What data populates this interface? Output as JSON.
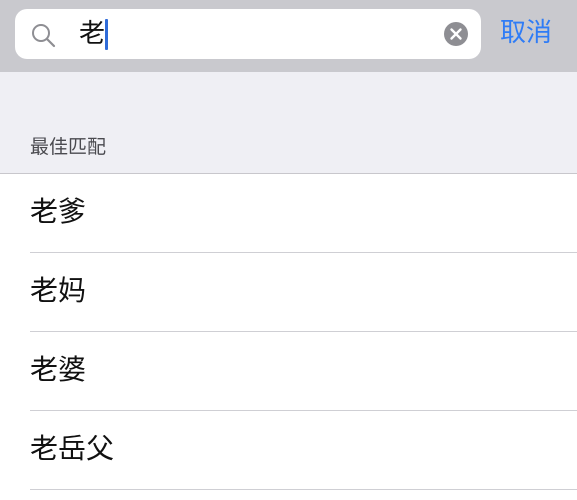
{
  "search": {
    "value": "老",
    "cancel_label": "取消"
  },
  "section": {
    "header": "最佳匹配"
  },
  "results": [
    {
      "label": "老爹"
    },
    {
      "label": "老妈"
    },
    {
      "label": "老婆"
    },
    {
      "label": "老岳父"
    }
  ],
  "colors": {
    "accent": "#2f7cf6",
    "caret": "#2f6bd8",
    "bar_bg": "#c9c9ce",
    "section_bg": "#efeff4"
  },
  "icons": [
    "search-icon",
    "clear-icon"
  ]
}
